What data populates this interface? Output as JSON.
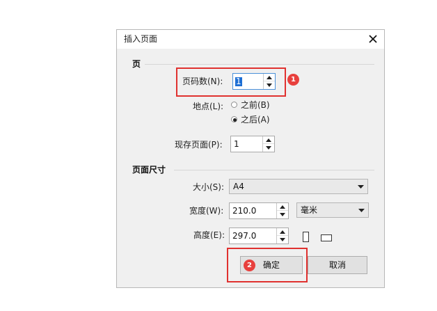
{
  "dialog": {
    "title": "插入页面",
    "close_icon": "close-icon"
  },
  "section_page": {
    "label": "页",
    "page_count": {
      "label": "页码数(N):",
      "value": "1"
    },
    "location": {
      "label": "地点(L):",
      "options": [
        {
          "label": "之前(B)",
          "selected": false
        },
        {
          "label": "之后(A)",
          "selected": true
        }
      ]
    },
    "existing_page": {
      "label": "现存页面(P):",
      "value": "1"
    }
  },
  "section_size": {
    "label": "页面尺寸",
    "size": {
      "label": "大小(S):",
      "value": "A4"
    },
    "width": {
      "label": "宽度(W):",
      "value": "210.0",
      "unit": "毫米"
    },
    "height": {
      "label": "高度(E):",
      "value": "297.0"
    },
    "orientation_icons": [
      "portrait-icon",
      "landscape-icon"
    ]
  },
  "buttons": {
    "ok": "确定",
    "cancel": "取消"
  },
  "annotations": {
    "badge_1": "1",
    "badge_2": "2",
    "color": "#e0312f"
  }
}
